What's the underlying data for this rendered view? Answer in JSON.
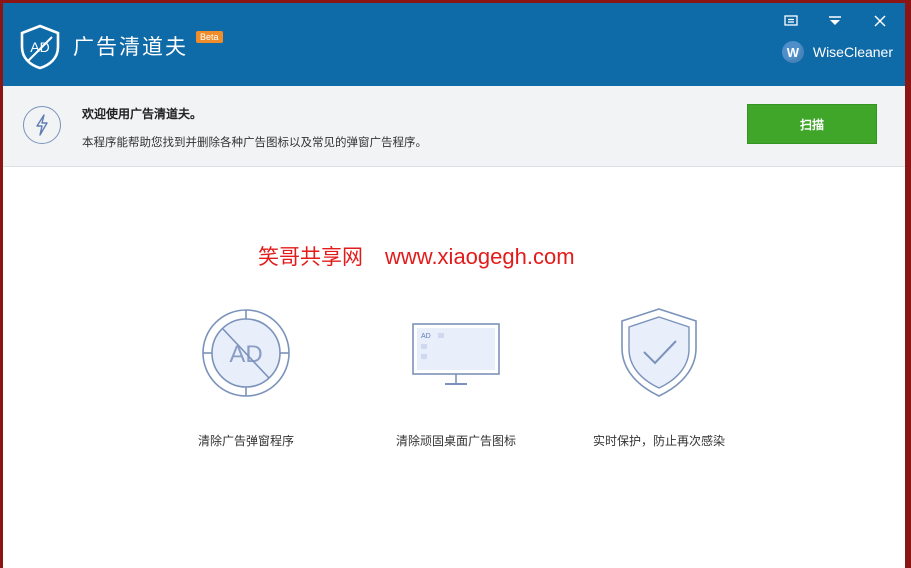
{
  "app": {
    "title": "广告清道夫",
    "badge": "Beta",
    "brand": "WiseCleaner",
    "brand_initial": "W"
  },
  "window_controls": {
    "feedback_icon": "menu-icon",
    "dropdown_icon": "chevron-down-icon",
    "close_icon": "close-icon"
  },
  "info": {
    "welcome": "欢迎使用广告清道夫。",
    "description": "本程序能帮助您找到并删除各种广告图标以及常见的弹窗广告程序。",
    "scan_label": "扫描"
  },
  "watermark": {
    "text": "笑哥共享网",
    "url": "www.xiaogegh.com"
  },
  "features": [
    {
      "label": "清除广告弹窗程序",
      "icon": "ad-block-icon",
      "icon_text": "AD"
    },
    {
      "label": "清除顽固桌面广告图标",
      "icon": "monitor-icon",
      "icon_text": "AD"
    },
    {
      "label": "实时保护，防止再次感染",
      "icon": "shield-check-icon"
    }
  ],
  "colors": {
    "titlebar": "#0f6aa8",
    "scan_button": "#3fa62a",
    "beta_badge": "#f08c2a",
    "watermark": "#e31b1b",
    "icon_stroke": "#7b93bb"
  }
}
